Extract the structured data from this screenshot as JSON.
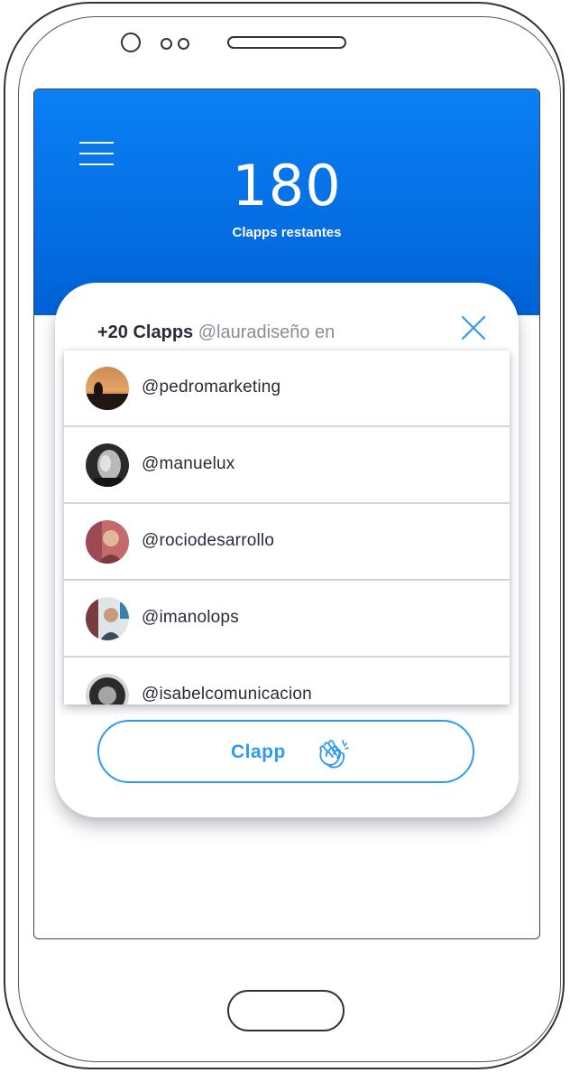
{
  "header": {
    "remaining_count": "180",
    "remaining_label": "Clapps restantes"
  },
  "card": {
    "title_amount": "+20 Clapps",
    "title_user": "@lauradiseño en",
    "users": [
      {
        "handle": "@pedromarketing"
      },
      {
        "handle": "@manuelux"
      },
      {
        "handle": "@rociodesarrollo"
      },
      {
        "handle": "@imanolops"
      },
      {
        "handle": "@isabelcomunicacion"
      }
    ],
    "clapp_button_label": "Clapp"
  },
  "colors": {
    "header_blue": "#0a80f5",
    "accent_blue": "#2e9bf3"
  },
  "icons": [
    "menu-icon",
    "close-icon",
    "clapping-hands-icon"
  ]
}
